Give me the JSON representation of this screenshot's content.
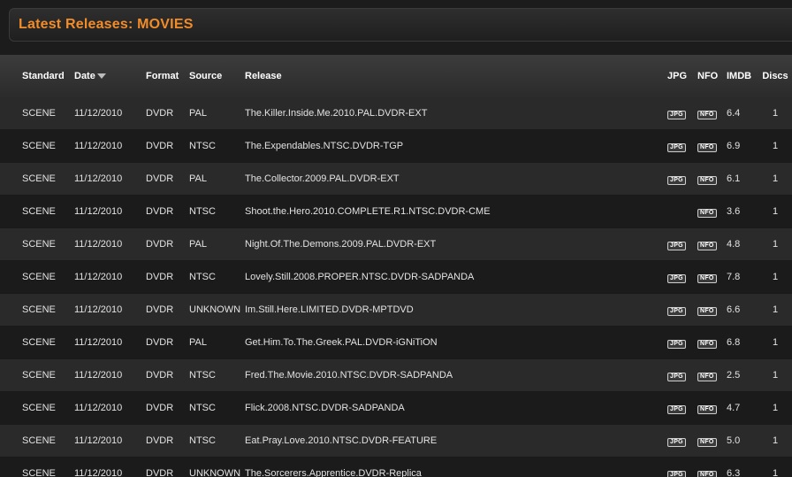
{
  "page": {
    "title": "Latest Releases: MOVIES"
  },
  "columns": {
    "standard": "Standard",
    "date": "Date",
    "format": "Format",
    "source": "Source",
    "release": "Release",
    "jpg": "JPG",
    "nfo": "NFO",
    "imdb": "IMDB",
    "discs": "Discs"
  },
  "badges": {
    "jpg": "JPG",
    "nfo": "NFO"
  },
  "rows": [
    {
      "standard": "SCENE",
      "date": "11/12/2010",
      "format": "DVDR",
      "source": "PAL",
      "release": "The.Killer.Inside.Me.2010.PAL.DVDR-EXT",
      "jpg": true,
      "nfo": true,
      "imdb": "6.4",
      "discs": "1"
    },
    {
      "standard": "SCENE",
      "date": "11/12/2010",
      "format": "DVDR",
      "source": "NTSC",
      "release": "The.Expendables.NTSC.DVDR-TGP",
      "jpg": true,
      "nfo": true,
      "imdb": "6.9",
      "discs": "1"
    },
    {
      "standard": "SCENE",
      "date": "11/12/2010",
      "format": "DVDR",
      "source": "PAL",
      "release": "The.Collector.2009.PAL.DVDR-EXT",
      "jpg": true,
      "nfo": true,
      "imdb": "6.1",
      "discs": "1"
    },
    {
      "standard": "SCENE",
      "date": "11/12/2010",
      "format": "DVDR",
      "source": "NTSC",
      "release": "Shoot.the.Hero.2010.COMPLETE.R1.NTSC.DVDR-CME",
      "jpg": false,
      "nfo": true,
      "imdb": "3.6",
      "discs": "1"
    },
    {
      "standard": "SCENE",
      "date": "11/12/2010",
      "format": "DVDR",
      "source": "PAL",
      "release": "Night.Of.The.Demons.2009.PAL.DVDR-EXT",
      "jpg": true,
      "nfo": true,
      "imdb": "4.8",
      "discs": "1"
    },
    {
      "standard": "SCENE",
      "date": "11/12/2010",
      "format": "DVDR",
      "source": "NTSC",
      "release": "Lovely.Still.2008.PROPER.NTSC.DVDR-SADPANDA",
      "jpg": true,
      "nfo": true,
      "imdb": "7.8",
      "discs": "1"
    },
    {
      "standard": "SCENE",
      "date": "11/12/2010",
      "format": "DVDR",
      "source": "UNKNOWN",
      "release": "Im.Still.Here.LIMITED.DVDR-MPTDVD",
      "jpg": true,
      "nfo": true,
      "imdb": "6.6",
      "discs": "1"
    },
    {
      "standard": "SCENE",
      "date": "11/12/2010",
      "format": "DVDR",
      "source": "PAL",
      "release": "Get.Him.To.The.Greek.PAL.DVDR-iGNiTiON",
      "jpg": true,
      "nfo": true,
      "imdb": "6.8",
      "discs": "1"
    },
    {
      "standard": "SCENE",
      "date": "11/12/2010",
      "format": "DVDR",
      "source": "NTSC",
      "release": "Fred.The.Movie.2010.NTSC.DVDR-SADPANDA",
      "jpg": true,
      "nfo": true,
      "imdb": "2.5",
      "discs": "1"
    },
    {
      "standard": "SCENE",
      "date": "11/12/2010",
      "format": "DVDR",
      "source": "NTSC",
      "release": "Flick.2008.NTSC.DVDR-SADPANDA",
      "jpg": true,
      "nfo": true,
      "imdb": "4.7",
      "discs": "1"
    },
    {
      "standard": "SCENE",
      "date": "11/12/2010",
      "format": "DVDR",
      "source": "NTSC",
      "release": "Eat.Pray.Love.2010.NTSC.DVDR-FEATURE",
      "jpg": true,
      "nfo": true,
      "imdb": "5.0",
      "discs": "1"
    },
    {
      "standard": "SCENE",
      "date": "11/12/2010",
      "format": "DVDR",
      "source": "UNKNOWN",
      "release": "The.Sorcerers.Apprentice.DVDR-Replica",
      "jpg": true,
      "nfo": true,
      "imdb": "6.3",
      "discs": "1"
    }
  ],
  "colors": {
    "title": "#f28c28",
    "background": "#1c1c1c",
    "row_odd": "#2a2a2a",
    "row_even": "#1b1b1b"
  }
}
